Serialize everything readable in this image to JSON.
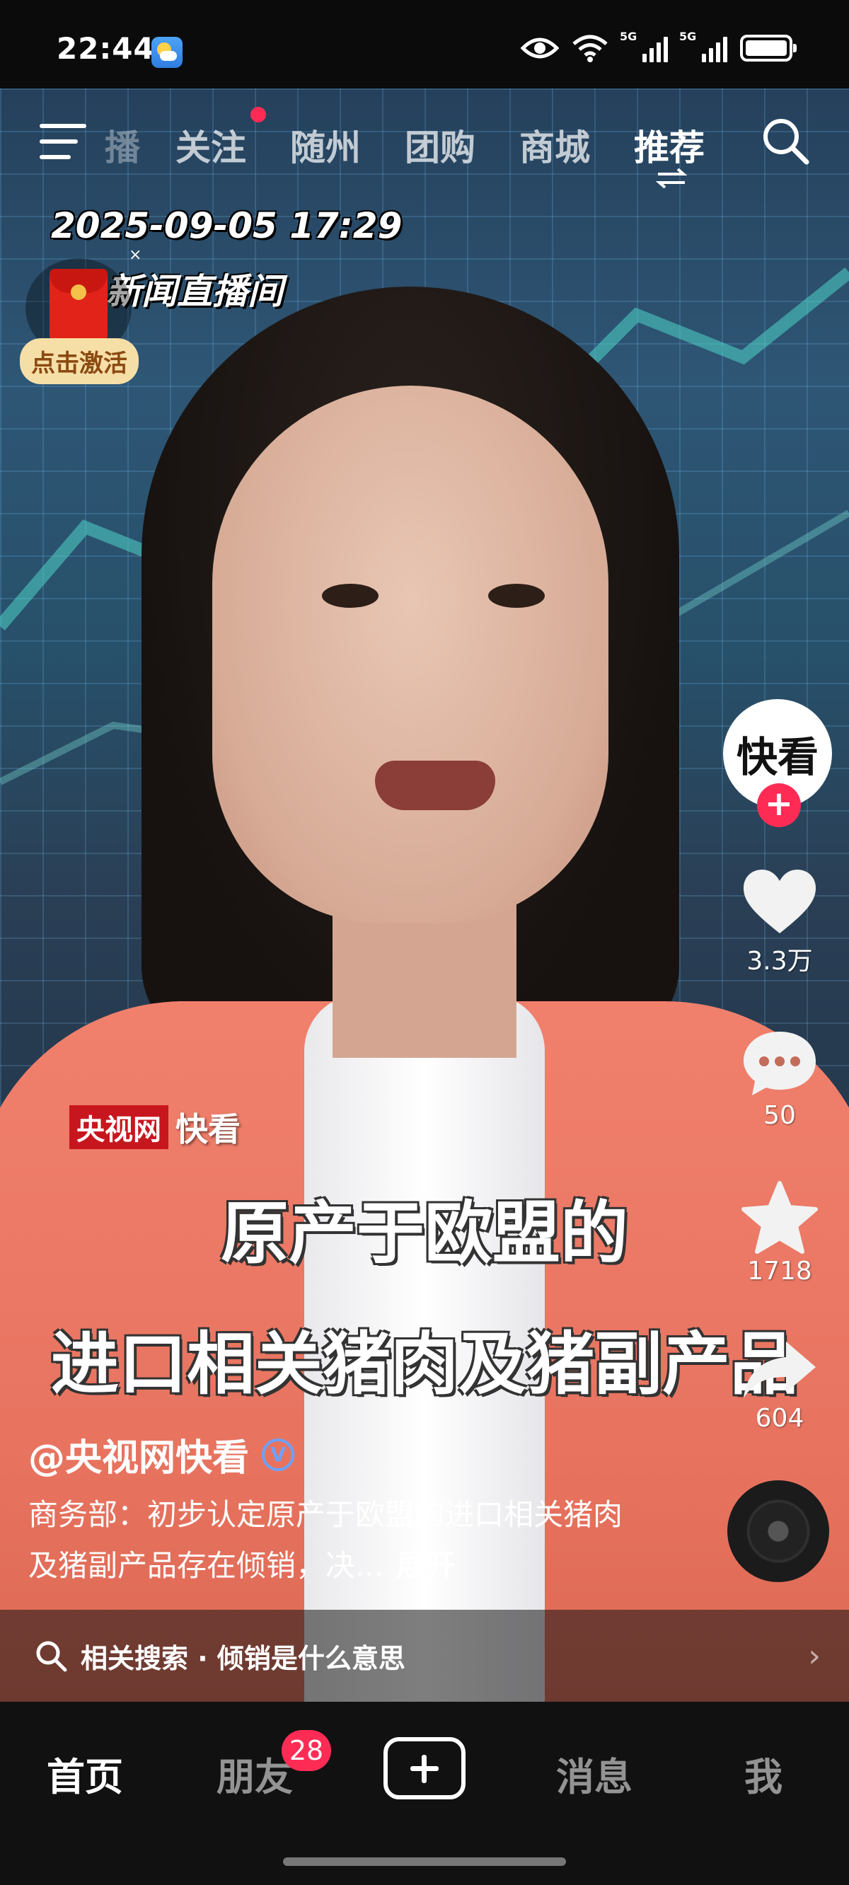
{
  "status_bar": {
    "time": "22:44",
    "network_1": "5G",
    "network_2": "5G"
  },
  "top_nav": {
    "partial_tab": "播",
    "tabs": [
      {
        "label": "关注",
        "has_dot": true
      },
      {
        "label": "随州"
      },
      {
        "label": "团购"
      },
      {
        "label": "商城"
      },
      {
        "label": "推荐",
        "active": true
      }
    ]
  },
  "video": {
    "timestamp": "2025-09-05 17:29",
    "channel_name": "新闻直播间",
    "red_packet": {
      "close": "×",
      "activate_label": "点击激活"
    },
    "watermark": {
      "logo_red": "央视网",
      "logo_white": "快看"
    },
    "subtitle_line1": "原产于欧盟的",
    "subtitle_line2": "进口相关猪肉及猪副产品"
  },
  "side_actions": {
    "avatar_text": "快看",
    "follow_plus": "+",
    "likes": "3.3万",
    "comments": "50",
    "favorites": "1718",
    "shares": "604"
  },
  "post": {
    "author": "@央视网快看",
    "verified_mark": "V",
    "description": "商务部：初步认定原产于欧盟的进口相关猪肉及猪副产品存在倾销，决...",
    "expand_label": "展开"
  },
  "related_search": {
    "text": "相关搜索 · 倾销是什么意思",
    "chevron": "›"
  },
  "bottom_nav": {
    "home": "首页",
    "friends": "朋友",
    "friends_badge": "28",
    "messages": "消息",
    "me": "我"
  },
  "colors": {
    "accent_red": "#fe2c55",
    "verified_blue": "#6ea1ff"
  }
}
